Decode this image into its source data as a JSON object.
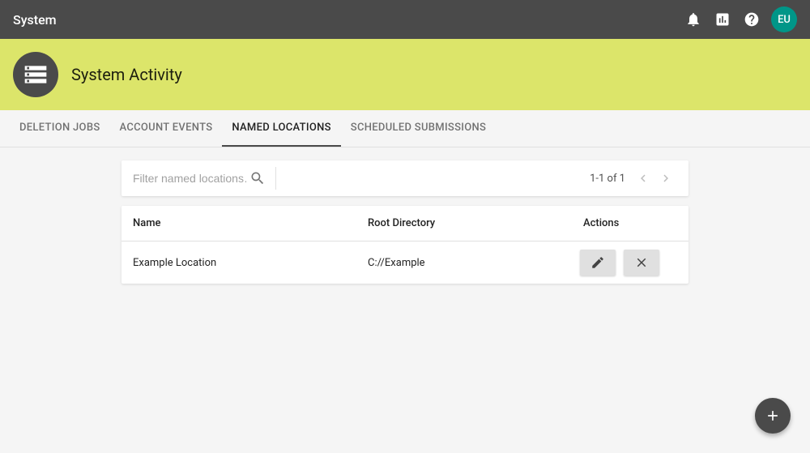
{
  "topbar": {
    "title": "System",
    "avatar_initials": "EU"
  },
  "hero": {
    "title": "System Activity"
  },
  "tabs": [
    {
      "label": "DELETION JOBS",
      "active": false
    },
    {
      "label": "ACCOUNT EVENTS",
      "active": false
    },
    {
      "label": "NAMED LOCATIONS",
      "active": true
    },
    {
      "label": "SCHEDULED SUBMISSIONS",
      "active": false
    }
  ],
  "filter": {
    "placeholder": "Filter named locations…",
    "pagination_text": "1-1 of 1"
  },
  "table": {
    "headers": {
      "name": "Name",
      "root": "Root Directory",
      "actions": "Actions"
    },
    "rows": [
      {
        "name": "Example Location",
        "root": "C://Example"
      }
    ]
  }
}
